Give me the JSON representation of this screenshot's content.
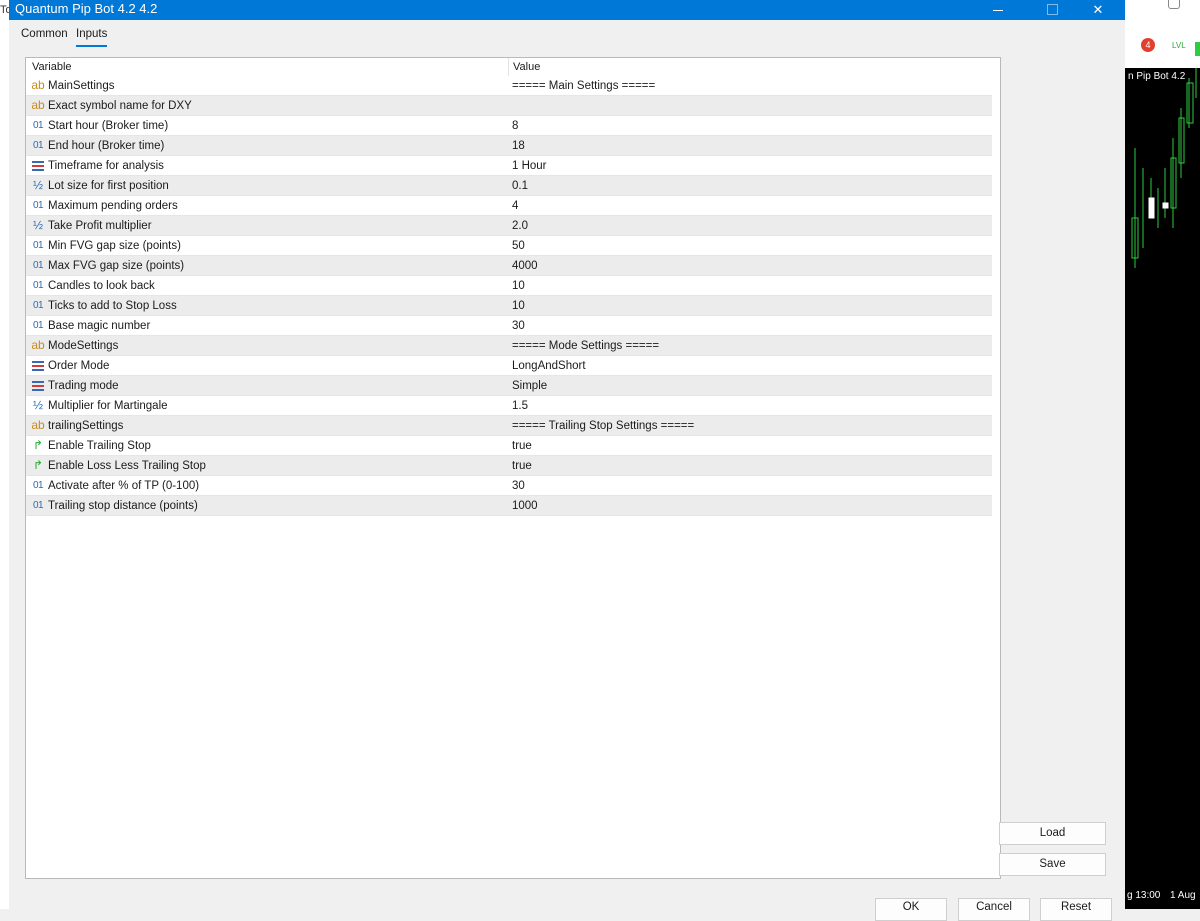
{
  "window": {
    "title": "Quantum Pip Bot 4.2 4.2",
    "minimize": "",
    "maximize": "",
    "close": "✕"
  },
  "background_left": {
    "text": "To"
  },
  "tabs": [
    {
      "label": "Common",
      "active": false
    },
    {
      "label": "Inputs",
      "active": true
    }
  ],
  "grid": {
    "col_variable": "Variable",
    "col_value": "Value",
    "rows": [
      {
        "type": "ab",
        "icon": "string-icon",
        "name": "MainSettings",
        "value": "===== Main Settings ====="
      },
      {
        "type": "ab",
        "icon": "string-icon",
        "name": "Exact symbol name for DXY",
        "value": ""
      },
      {
        "type": "int",
        "icon": "integer-icon",
        "name": "Start hour (Broker time)",
        "value": "8"
      },
      {
        "type": "int",
        "icon": "integer-icon",
        "name": "End hour (Broker time)",
        "value": "18"
      },
      {
        "type": "enum",
        "icon": "enum-icon",
        "name": "Timeframe for analysis",
        "value": "1 Hour"
      },
      {
        "type": "dbl",
        "icon": "double-icon",
        "name": "Lot size for first position",
        "value": "0.1"
      },
      {
        "type": "int",
        "icon": "integer-icon",
        "name": "Maximum pending orders",
        "value": "4"
      },
      {
        "type": "dbl",
        "icon": "double-icon",
        "name": "Take Profit multiplier",
        "value": "2.0"
      },
      {
        "type": "int",
        "icon": "integer-icon",
        "name": "Min FVG gap size (points)",
        "value": "50"
      },
      {
        "type": "int",
        "icon": "integer-icon",
        "name": "Max FVG gap size (points)",
        "value": "4000"
      },
      {
        "type": "int",
        "icon": "integer-icon",
        "name": "Candles to look back",
        "value": "10"
      },
      {
        "type": "int",
        "icon": "integer-icon",
        "name": "Ticks to add to Stop Loss",
        "value": "10"
      },
      {
        "type": "int",
        "icon": "integer-icon",
        "name": "Base magic number",
        "value": "30"
      },
      {
        "type": "ab",
        "icon": "string-icon",
        "name": "ModeSettings",
        "value": "===== Mode Settings ====="
      },
      {
        "type": "enum",
        "icon": "enum-icon",
        "name": "Order Mode",
        "value": "LongAndShort"
      },
      {
        "type": "enum",
        "icon": "enum-icon",
        "name": "Trading mode",
        "value": "Simple"
      },
      {
        "type": "dbl",
        "icon": "double-icon",
        "name": "Multiplier for Martingale",
        "value": "1.5"
      },
      {
        "type": "ab",
        "icon": "string-icon",
        "name": "trailingSettings",
        "value": "===== Trailing Stop Settings ====="
      },
      {
        "type": "bool",
        "icon": "bool-icon",
        "name": "Enable Trailing Stop",
        "value": "true"
      },
      {
        "type": "bool",
        "icon": "bool-icon",
        "name": "Enable Loss Less Trailing Stop",
        "value": "true"
      },
      {
        "type": "int",
        "icon": "integer-icon",
        "name": "Activate after % of TP (0-100)",
        "value": "30"
      },
      {
        "type": "int",
        "icon": "integer-icon",
        "name": "Trailing stop distance (points)",
        "value": "1000"
      }
    ]
  },
  "icon_glyphs": {
    "ab": "ab",
    "int": "01",
    "dbl": "½",
    "bool": "↱",
    "enum": ""
  },
  "buttons": {
    "load": "Load",
    "save": "Save",
    "ok": "OK",
    "cancel": "Cancel",
    "reset": "Reset"
  },
  "chart": {
    "label": "n Pip Bot 4.2",
    "badge_count": "4",
    "lvl": "LVL",
    "time_labels": [
      "g 13:00",
      "1 Aug"
    ]
  },
  "colors": {
    "titlebar": "#0078d7",
    "accent": "#0078d7",
    "candle": "#2ecc40"
  }
}
